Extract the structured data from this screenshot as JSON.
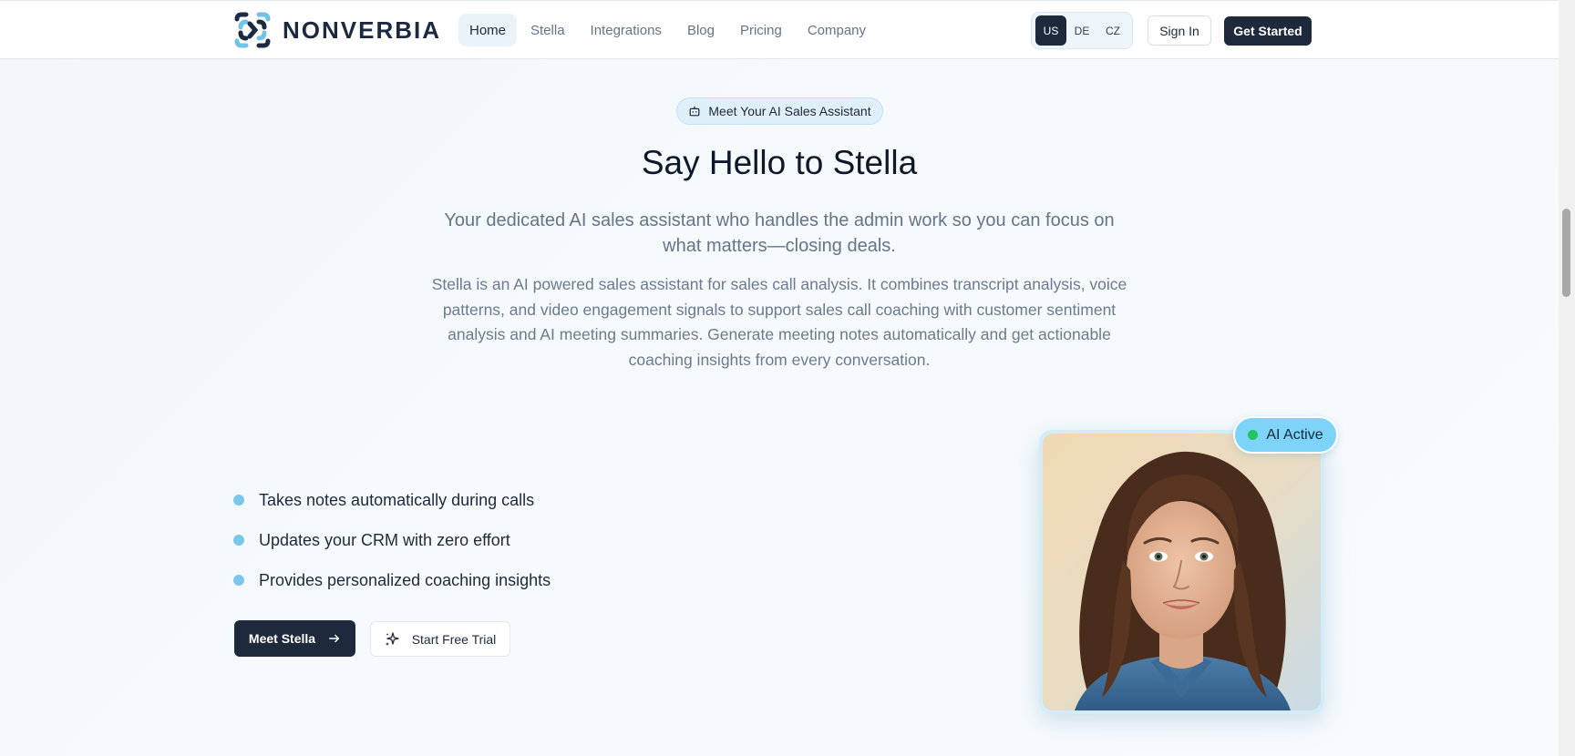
{
  "brand": {
    "name": "NONVERBIA",
    "colors": {
      "navy": "#1e293b",
      "accent": "#7cc6ec",
      "badge_bg": "#dff0f9",
      "status_green": "#22c55e"
    }
  },
  "nav": {
    "items": [
      {
        "label": "Home",
        "active": true
      },
      {
        "label": "Stella",
        "active": false
      },
      {
        "label": "Integrations",
        "active": false
      },
      {
        "label": "Blog",
        "active": false
      },
      {
        "label": "Pricing",
        "active": false
      },
      {
        "label": "Company",
        "active": false
      }
    ]
  },
  "languages": {
    "options": [
      "US",
      "DE",
      "CZ"
    ],
    "selected": "US"
  },
  "header_actions": {
    "sign_in": "Sign In",
    "get_started": "Get Started"
  },
  "hero": {
    "badge": "Meet Your AI Sales Assistant",
    "badge_icon": "robot-icon",
    "title": "Say Hello to Stella",
    "subtitle": "Your dedicated AI sales assistant who handles the admin work so you can focus on what matters—closing deals.",
    "description": "Stella is an AI powered sales assistant for sales call analysis. It combines transcript analysis, voice patterns, and video engagement signals to support sales call coaching with customer sentiment analysis and AI meeting summaries. Generate meeting notes automatically and get actionable coaching insights from every conversation."
  },
  "features": [
    "Takes notes automatically during calls",
    "Updates your CRM with zero effort",
    "Provides personalized coaching insights"
  ],
  "cta": {
    "primary": "Meet Stella",
    "primary_icon": "arrow-right-icon",
    "secondary": "Start Free Trial",
    "secondary_icon": "sparkles-icon"
  },
  "portrait": {
    "status": "AI Active"
  }
}
